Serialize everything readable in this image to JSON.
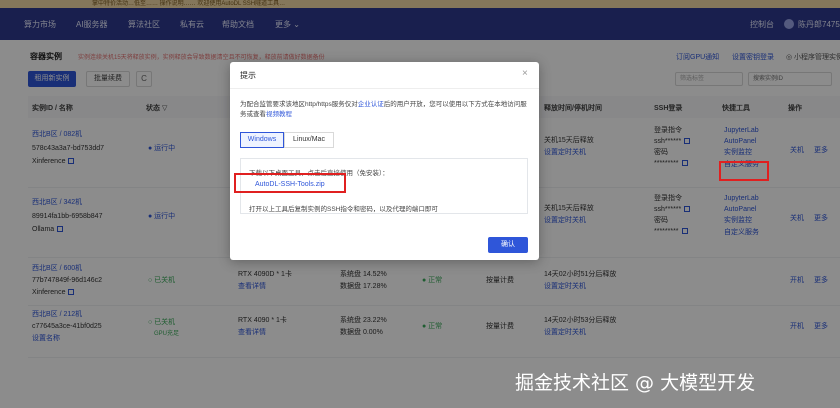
{
  "banner": {
    "text": "掌中特价活动…低至…… 操作说明…… 欢迎使用AutoDL SSH隧道工具…"
  },
  "nav": {
    "items": [
      "算力市场",
      "AI服务器",
      "算法社区",
      "私有云",
      "帮助文档",
      "更多 ⌄"
    ],
    "right_console": "控制台",
    "right_user": "陈丹郎7475"
  },
  "page": {
    "title": "容器实例",
    "tip": "实例连续关机15天将释放实例，实例释放会导致数据清空且不可恢复，释放前请做好数据备份",
    "links": [
      "订阅GPU通知",
      "设置密钥登录",
      "◎ 小程序管理实例"
    ],
    "btn_rent": "租用新实例",
    "btn_renew": "批量续费",
    "btn_refresh": "C",
    "filter_placeholder": "筛选标签",
    "search_placeholder": "搜索实例ID"
  },
  "table": {
    "headers": [
      "实例ID / 名称",
      "状态 ▽",
      "",
      "",
      "",
      "",
      "释放时间/停机时间",
      "SSH登录",
      "快捷工具",
      "操作"
    ],
    "rows": [
      {
        "region": "西北B区 / 082机",
        "id": "578c43a3a7-bd753dd7",
        "name": "Xinference",
        "status": "● 运行中",
        "release": "关机15天后释放",
        "release_link": "设置定时关机",
        "ssh_cmd": "登录指令",
        "ssh_user": "ssh******",
        "ssh_pwd_label": "密码",
        "ssh_pwd": "*********",
        "tools": [
          "JupyterLab",
          "AutoPanel",
          "实例监控",
          "自定义服务"
        ],
        "ops": [
          "关机",
          "更多"
        ]
      },
      {
        "region": "西北B区 / 342机",
        "id": "89914fa1bb-6958b847",
        "name": "Ollama",
        "status": "● 运行中",
        "release": "关机15天后释放",
        "release_link": "设置定时关机",
        "ssh_cmd": "登录指令",
        "ssh_user": "ssh******",
        "ssh_pwd_label": "密码",
        "ssh_pwd": "*********",
        "tools": [
          "JupyterLab",
          "AutoPanel",
          "实例监控",
          "自定义服务"
        ],
        "ops": [
          "关机",
          "更多"
        ]
      },
      {
        "region": "西北B区 / 600机",
        "id": "77b747849f-96d146c2",
        "name": "Xinference",
        "status": "○ 已关机",
        "gpu": "RTX 4090D * 1卡",
        "gpu_link": "查看详情",
        "disk_sys": "系统盘 14.52%",
        "disk_data": "数据盘 17.28%",
        "health": "● 正常",
        "billing": "按量计费",
        "release": "14天02小时51分后释放",
        "release_link": "设置定时关机",
        "ops": [
          "开机",
          "更多"
        ]
      },
      {
        "region": "西北B区 / 212机",
        "id": "c77645a3ce-41bf0d25",
        "name": "",
        "name_link": "设置名称",
        "status": "○ 已关机",
        "status_sub": "GPU充足",
        "gpu": "RTX 4090 * 1卡",
        "gpu_link": "查看详情",
        "disk_sys": "系统盘 23.22%",
        "disk_data": "数据盘 0.00%",
        "health": "● 正常",
        "billing": "按量计费",
        "release": "14天02小时53分后释放",
        "release_link": "设置定时关机",
        "ops": [
          "开机",
          "更多"
        ]
      }
    ]
  },
  "dialog": {
    "title": "提示",
    "close": "×",
    "desc_part1": "为配合监管要求该地区http/https服务仅对",
    "desc_link1": "企业认证",
    "desc_part2": "后的用户开放，您可以使用以下方式在本地访问服务或查看",
    "desc_link2": "视频教程",
    "tab_windows": "Windows",
    "tab_mac": "Linux/Mac",
    "box_text1": "下载以下桌面工具，点击后直接使用（免安装）：",
    "download": "AutoDL-SSH-Tools.zip",
    "box_text2": "打开以上工具后复制实例的SSH指令和密码，以及代理的端口即可",
    "confirm": "确认"
  },
  "watermark": "掘金技术社区 @ 大模型开发",
  "colors": {
    "primary": "#2f56d9",
    "nav_bg": "#2f3a8f",
    "highlight": "#e02020",
    "running": "#3aaa5a"
  }
}
